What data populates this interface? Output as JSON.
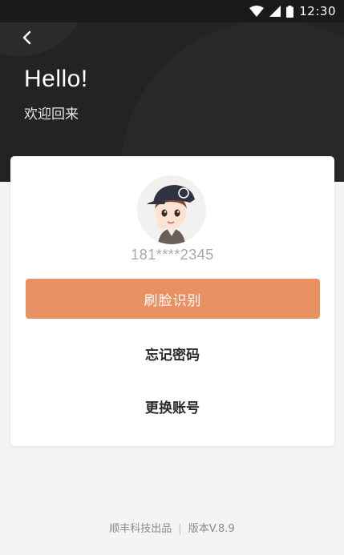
{
  "status_bar": {
    "time": "12:30",
    "icons": [
      "wifi-icon",
      "signal-icon",
      "battery-icon"
    ]
  },
  "header": {
    "back_icon": "chevron-left-icon",
    "greeting": "Hello!",
    "subtitle": "欢迎回来"
  },
  "card": {
    "avatar": "user-avatar",
    "phone": "181****2345",
    "face_button": "刷脸识别",
    "forgot_password": "忘记密码",
    "switch_account": "更换账号"
  },
  "footer": {
    "brand": "顺丰科技出品",
    "version": "版本V.8.9"
  },
  "colors": {
    "header_bg": "#232326",
    "accent": "#ea9163",
    "page_bg": "#f4f4f4"
  }
}
